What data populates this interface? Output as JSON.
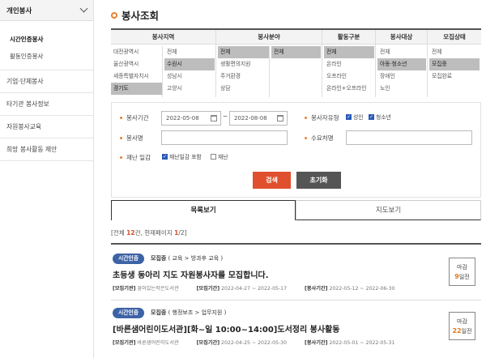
{
  "sidebar": {
    "header": "개인봉사",
    "sub_items": [
      "시간인증봉사",
      "활동인증봉사"
    ],
    "items": [
      "기업·단체봉사",
      "타기관 봉사정보",
      "자원봉사교육",
      "희망 봉사활동 제안"
    ]
  },
  "page_title": "봉사조회",
  "filters": {
    "region_header": "봉사지역",
    "region_left": [
      "대전광역시",
      "울산광역시",
      "세종특별자치시",
      "경기도"
    ],
    "region_right": [
      "전체",
      "수원시",
      "성남시",
      "고양시"
    ],
    "field_header": "봉사분야",
    "field_left": [
      "전체",
      "생활편의지원",
      "주거환경",
      "상담"
    ],
    "field_right": [
      "전체"
    ],
    "activity_header": "활동구분",
    "activity": [
      "전체",
      "온라인",
      "오프라인",
      "온라인+오프라인"
    ],
    "target_header": "봉사대상",
    "target": [
      "전체",
      "아동·청소년",
      "장애인",
      "노인"
    ],
    "recruit_header": "모집상태",
    "recruit": [
      "전체",
      "모집중",
      "모집완료"
    ]
  },
  "search": {
    "period_label": "봉사기간",
    "start_date": "2022-05-08",
    "tilde": "~",
    "end_date": "2022-08-08",
    "type_label": "봉사자유형",
    "type_adult": "성인",
    "type_youth": "청소년",
    "name_label": "봉사명",
    "demand_label": "수요처명",
    "disaster_label": "재난 일감",
    "disaster_include": "재난일감 포함",
    "disaster_only": "재난",
    "search_btn": "검색",
    "reset_btn": "초기화"
  },
  "tabs": {
    "list": "목록보기",
    "map": "지도보기"
  },
  "count": {
    "prefix": "[전체 ",
    "total": "12",
    "mid": "건, 현재페이지 ",
    "page": "1",
    "suffix": "/2]"
  },
  "cards": [
    {
      "badge": "시간인증",
      "status": "모집중",
      "category": "( 교육 > 방과후 교육 )",
      "title": "초등생 동아리 지도 자원봉사자를 모집합니다.",
      "org_label": "[모집기관]",
      "org": "꿈이있는작은도서관",
      "recruit_label": "[모집기간]",
      "recruit_period": "2022-04-27 ~ 2022-05-17",
      "vol_label": "[봉사기간]",
      "vol_period": "2022-05-12 ~ 2022-06-30",
      "dday_label": "마감",
      "dday_num": "9",
      "dday_unit": "일전"
    },
    {
      "badge": "시간인증",
      "status": "모집중",
      "category": "( 행정보조 > 업무지원 )",
      "title": "[바른샘어린이도서관][화~일 10:00~14:00]도서정리 봉사활동",
      "org_label": "[모집기관]",
      "org": "바른샘어린이도서관",
      "recruit_label": "[모집기간]",
      "recruit_period": "2022-04-25 ~ 2022-05-30",
      "vol_label": "[봉사기간]",
      "vol_period": "2022-05-01 ~ 2022-05-31",
      "dday_label": "마감",
      "dday_num": "22",
      "dday_unit": "일전"
    }
  ],
  "colors": {
    "accent": "#f07d2c",
    "badge": "#3d62a6",
    "search_btn": "#e0502e",
    "reset_btn": "#555555",
    "selected": "#bdbdbd"
  }
}
